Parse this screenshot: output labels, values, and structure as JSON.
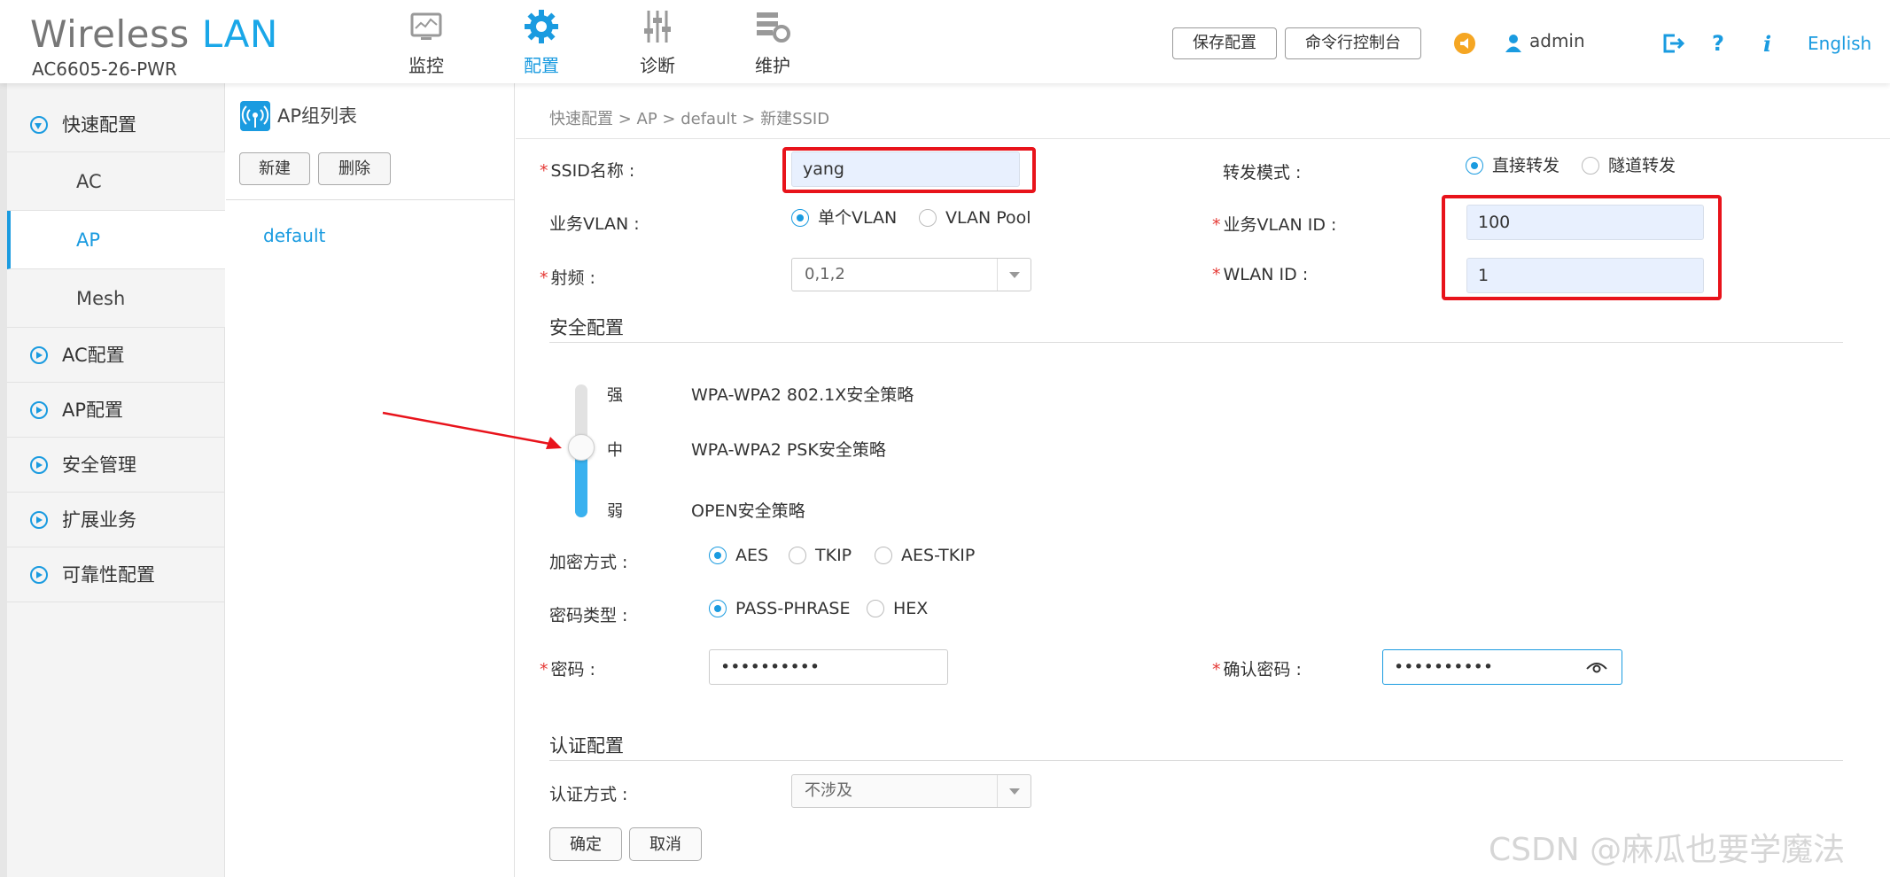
{
  "brand": {
    "wireless": "Wireless",
    "lan": "LAN",
    "model": "AC6605-26-PWR"
  },
  "nav": [
    {
      "label": "监控",
      "icon": "monitor-icon"
    },
    {
      "label": "配置",
      "icon": "gear-icon",
      "active": true
    },
    {
      "label": "诊断",
      "icon": "sliders-icon"
    },
    {
      "label": "维护",
      "icon": "maintenance-icon"
    }
  ],
  "header": {
    "save_label": "保存配置",
    "cli_label": "命令行控制台",
    "user": "admin",
    "language": "English",
    "icons": [
      "notification-icon",
      "user-icon",
      "logout-icon",
      "help-icon",
      "info-icon"
    ]
  },
  "sidebar": {
    "groups": [
      {
        "label": "快速配置",
        "expanded": true,
        "children": [
          "AC",
          "AP",
          "Mesh"
        ],
        "active_child": "AP"
      },
      {
        "label": "AC配置"
      },
      {
        "label": "AP配置"
      },
      {
        "label": "安全管理"
      },
      {
        "label": "扩展业务"
      },
      {
        "label": "可靠性配置"
      }
    ]
  },
  "ap_group_panel": {
    "title": "AP组列表",
    "new_label": "新建",
    "delete_label": "删除",
    "items": [
      "default"
    ]
  },
  "breadcrumb": "快速配置 > AP > default > 新建SSID",
  "form": {
    "ssid_label": "SSID名称 :",
    "ssid_value": "yang",
    "forward_label": "转发模式 :",
    "forward_options": [
      "直接转发",
      "隧道转发"
    ],
    "forward_selected": "直接转发",
    "vlan_label": "业务VLAN :",
    "vlan_options": [
      "单个VLAN",
      "VLAN Pool"
    ],
    "vlan_selected": "单个VLAN",
    "vlan_id_label": "业务VLAN ID :",
    "vlan_id_value": "100",
    "radio_label": "射频 :",
    "radio_value": "0,1,2",
    "wlan_id_label": "WLAN ID :",
    "wlan_id_value": "1"
  },
  "security": {
    "section_title": "安全配置",
    "levels": [
      {
        "level": "强",
        "policy": "WPA-WPA2 802.1X安全策略"
      },
      {
        "level": "中",
        "policy": "WPA-WPA2 PSK安全策略"
      },
      {
        "level": "弱",
        "policy": "OPEN安全策略"
      }
    ],
    "selected_level": "中",
    "encryption_label": "加密方式 :",
    "encryption_options": [
      "AES",
      "TKIP",
      "AES-TKIP"
    ],
    "encryption_selected": "AES",
    "key_type_label": "密码类型 :",
    "key_type_options": [
      "PASS-PHRASE",
      "HEX"
    ],
    "key_type_selected": "PASS-PHRASE",
    "password_label": "密码 :",
    "password_value": "••••••••••",
    "confirm_label": "确认密码 :",
    "confirm_value": "••••••••••"
  },
  "auth": {
    "section_title": "认证配置",
    "method_label": "认证方式 :",
    "method_value": "不涉及"
  },
  "buttons": {
    "ok": "确定",
    "cancel": "取消"
  },
  "watermark": "CSDN @麻瓜也要学魔法",
  "colors": {
    "accent": "#1a9be0",
    "highlight_box": "#e8131b",
    "required": "#e53935"
  }
}
